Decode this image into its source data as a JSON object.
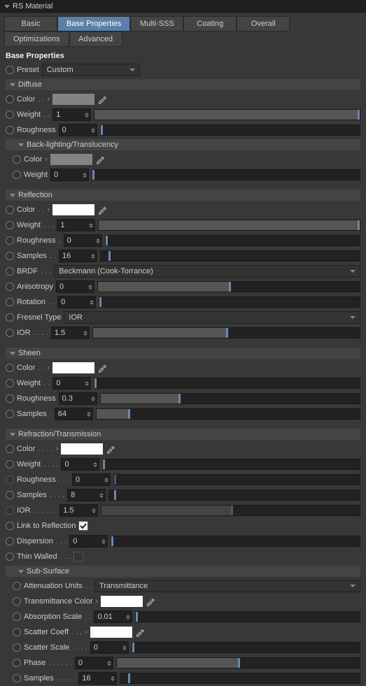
{
  "title": "RS Material",
  "tabs": [
    "Basic",
    "Base Properties",
    "Multi-SSS",
    "Coating",
    "Overall"
  ],
  "tabs2": [
    "Optimizations",
    "Advanced"
  ],
  "section_title": "Base Properties",
  "preset_label": "Preset",
  "preset_value": "Custom",
  "diffuse": {
    "h": "Diffuse",
    "color": "Color",
    "color_v": "#838383",
    "weight": "Weight",
    "weight_v": "1",
    "rough": "Roughness",
    "rough_v": "0"
  },
  "back": {
    "h": "Back-lighting/Translucency",
    "color": "Color",
    "color_v": "#838383",
    "weight": "Weight",
    "weight_v": "0"
  },
  "refl": {
    "h": "Reflection",
    "color": "Color",
    "color_v": "#ffffff",
    "weight": "Weight",
    "weight_v": "1",
    "rough": "Roughness",
    "rough_v": "0",
    "samp": "Samples",
    "samp_v": "16",
    "brdf": "BRDF",
    "brdf_v": "Beckmann (Cook-Torrance)",
    "aniso": "Anisotropy",
    "aniso_v": "0",
    "rot": "Rotation",
    "rot_v": "0",
    "ftype": "Fresnel Type",
    "ftype_v": "IOR",
    "ior": "IOR",
    "ior_v": "1.5"
  },
  "sheen": {
    "h": "Sheen",
    "color": "Color",
    "color_v": "#ffffff",
    "weight": "Weight",
    "weight_v": "0",
    "rough": "Roughness",
    "rough_v": "0.3",
    "samp": "Samples",
    "samp_v": "64"
  },
  "refr": {
    "h": "Refraction/Transmission",
    "color": "Color",
    "color_v": "#ffffff",
    "weight": "Weight",
    "weight_v": "0",
    "rough": "Roughness",
    "rough_v": "0",
    "samp": "Samples",
    "samp_v": "8",
    "ior": "IOR",
    "ior_v": "1.5",
    "link": "Link to Reflection",
    "disp": "Dispersion",
    "disp_v": "0",
    "thin": "Thin Walled"
  },
  "sub": {
    "h": "Sub-Surface",
    "atten": "Attenuation Units",
    "atten_v": "Transmittance",
    "tcol": "Transmittance Color",
    "tcol_v": "#ffffff",
    "abs": "Absorption Scale",
    "abs_v": "0.01",
    "scoe": "Scatter Coeff",
    "scoe_v": "#ffffff",
    "sscl": "Scatter Scale",
    "sscl_v": "0",
    "phase": "Phase",
    "phase_v": "0",
    "samp": "Samples",
    "samp_v": "16"
  }
}
